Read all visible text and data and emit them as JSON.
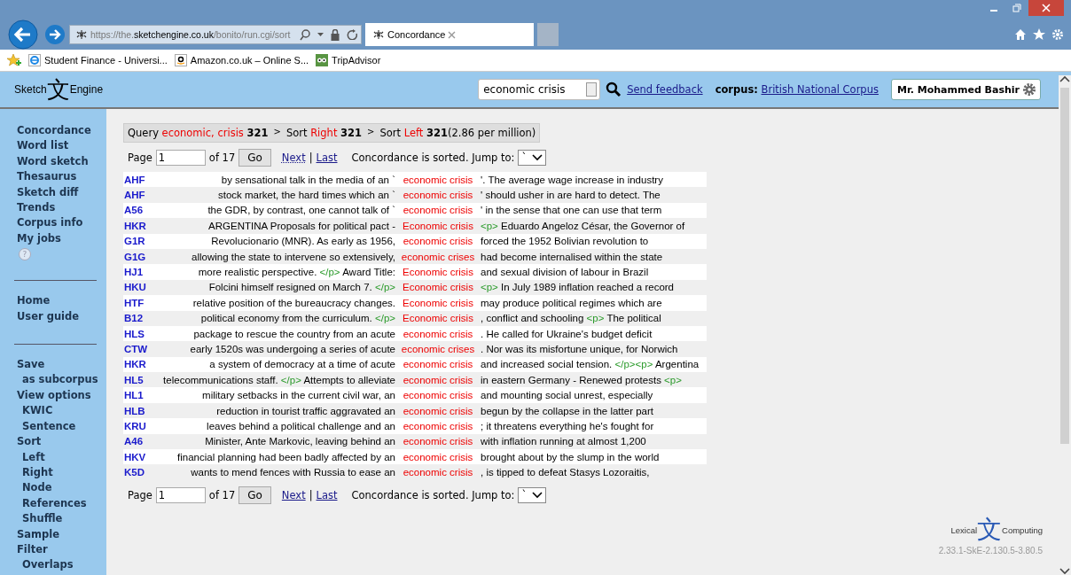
{
  "browser": {
    "address": {
      "scheme": "https://",
      "pre": "the.",
      "host": "sketchengine.co.uk",
      "path": "/bonito/run.cgi/sort"
    },
    "tab": "Concordance",
    "favorites": [
      {
        "kind": "edge",
        "label": "Student Finance - Universi..."
      },
      {
        "kind": "amazon",
        "label": "Amazon.co.uk – Online S..."
      },
      {
        "kind": "owl",
        "label": "TripAdvisor"
      }
    ]
  },
  "header": {
    "logo_glyph": "文",
    "logo_left": "Sketch",
    "logo_right": "Engine",
    "search": "economic crisis",
    "feedback": "Send feedback",
    "corpus_label": "corpus:",
    "corpus": "British National Corpus",
    "user": "Mr. Mohammed Bashir"
  },
  "sidebar": {
    "groups": [
      [
        {
          "label": "Concordance",
          "sub": false
        },
        {
          "label": "Word list",
          "sub": false
        },
        {
          "label": "Word sketch",
          "sub": false
        },
        {
          "label": "Thesaurus",
          "sub": false
        },
        {
          "label": "Sketch diff",
          "sub": false
        },
        {
          "label": "Trends",
          "sub": false
        },
        {
          "label": "Corpus info",
          "sub": false
        },
        {
          "label": "My jobs",
          "sub": false
        }
      ],
      [
        {
          "label": "Home",
          "sub": false
        },
        {
          "label": "User guide",
          "sub": false
        }
      ],
      [
        {
          "label": "Save",
          "sub": false
        },
        {
          "label": "as subcorpus",
          "sub": true
        },
        {
          "label": "View options",
          "sub": false
        },
        {
          "label": "KWIC",
          "sub": true
        },
        {
          "label": "Sentence",
          "sub": true
        },
        {
          "label": "Sort",
          "sub": false
        },
        {
          "label": "Left",
          "sub": true
        },
        {
          "label": "Right",
          "sub": true
        },
        {
          "label": "Node",
          "sub": true
        },
        {
          "label": "References",
          "sub": true
        },
        {
          "label": "Shuffle",
          "sub": true
        },
        {
          "label": "Sample",
          "sub": false
        },
        {
          "label": "Filter",
          "sub": false
        },
        {
          "label": "Overlaps",
          "sub": true
        }
      ]
    ]
  },
  "help": "?",
  "breadcrumb": [
    {
      "label": "Query",
      "value": "economic, crisis",
      "count": "321"
    },
    {
      "sep": ">",
      "label": "Sort",
      "value": "Right",
      "count": "321"
    },
    {
      "sep": ">",
      "label": "Sort",
      "value": "Left",
      "count": "321",
      "extra": "(2.86 per million)"
    }
  ],
  "pager_top": {
    "page_label": "Page",
    "page": "1",
    "of": "of 17",
    "go": "Go",
    "next": "Next",
    "sep": "|",
    "last": "Last",
    "note": "Concordance is sorted. Jump to:",
    "jump": "`"
  },
  "rows": [
    {
      "ref": "AHF",
      "left": [
        {
          "t": "by sensational talk in the media of an `",
          "tag": false
        }
      ],
      "kw": "economic crisis",
      "right": [
        {
          "t": "'. The average wage increase in industry",
          "tag": false
        }
      ]
    },
    {
      "ref": "AHF",
      "left": [
        {
          "t": "stock market, the hard times which an `",
          "tag": false
        }
      ],
      "kw": "economic crisis",
      "right": [
        {
          "t": "' should usher in are hard to detect. The",
          "tag": false
        }
      ]
    },
    {
      "ref": "A56",
      "left": [
        {
          "t": "the GDR, by contrast, one cannot talk of `",
          "tag": false
        }
      ],
      "kw": "economic crisis",
      "right": [
        {
          "t": "' in the sense that one can use that term",
          "tag": false
        }
      ]
    },
    {
      "ref": "HKR",
      "left": [
        {
          "t": "ARGENTINA Proposals for political pact -",
          "tag": false
        }
      ],
      "kw": "Economic crisis",
      "right": [
        {
          "t": "<p>",
          "tag": true
        },
        {
          "t": "Eduardo Angeloz César, the Governor of",
          "tag": false
        }
      ]
    },
    {
      "ref": "G1R",
      "left": [
        {
          "t": "Revolucionario (MNR). As early as 1956,",
          "tag": false
        }
      ],
      "kw": "economic crisis",
      "right": [
        {
          "t": "forced the 1952 Bolivian revolution to",
          "tag": false
        }
      ]
    },
    {
      "ref": "G1G",
      "left": [
        {
          "t": "allowing the state to intervene so extensively,",
          "tag": false
        }
      ],
      "kw": "economic crises",
      "right": [
        {
          "t": "had become internalised within the state",
          "tag": false
        }
      ]
    },
    {
      "ref": "HJ1",
      "left": [
        {
          "t": "more realistic perspective.",
          "tag": false
        },
        {
          "t": "</p>",
          "tag": true
        },
        {
          "t": "Award Title:",
          "tag": false
        }
      ],
      "kw": "Economic crisis",
      "right": [
        {
          "t": "and sexual division of labour in Brazil",
          "tag": false
        }
      ]
    },
    {
      "ref": "HKU",
      "left": [
        {
          "t": "Folcini himself resigned on March 7.",
          "tag": false
        },
        {
          "t": "</p>",
          "tag": true
        }
      ],
      "kw": "Economic crisis",
      "right": [
        {
          "t": "<p>",
          "tag": true
        },
        {
          "t": "In July 1989 inflation reached a record",
          "tag": false
        }
      ]
    },
    {
      "ref": "HTF",
      "left": [
        {
          "t": "relative position of the bureaucracy changes.",
          "tag": false
        }
      ],
      "kw": "Economic crisis",
      "right": [
        {
          "t": "may produce political regimes which are",
          "tag": false
        }
      ]
    },
    {
      "ref": "B12",
      "left": [
        {
          "t": "political economy from the curriculum.",
          "tag": false
        },
        {
          "t": "</p>",
          "tag": true
        }
      ],
      "kw": "Economic crisis",
      "right": [
        {
          "t": ", conflict and schooling",
          "tag": false
        },
        {
          "t": "<p>",
          "tag": true
        },
        {
          "t": "The political",
          "tag": false
        }
      ]
    },
    {
      "ref": "HLS",
      "left": [
        {
          "t": "package to rescue the country from an acute",
          "tag": false
        }
      ],
      "kw": "economic crisis",
      "right": [
        {
          "t": ". He called for Ukraine's budget deficit",
          "tag": false
        }
      ]
    },
    {
      "ref": "CTW",
      "left": [
        {
          "t": "early 1520s was undergoing a series of acute",
          "tag": false
        }
      ],
      "kw": "economic crises",
      "right": [
        {
          "t": ". Nor was its misfortune unique, for Norwich",
          "tag": false
        }
      ]
    },
    {
      "ref": "HKR",
      "left": [
        {
          "t": "a system of democracy at a time of acute",
          "tag": false
        }
      ],
      "kw": "economic crisis",
      "right": [
        {
          "t": "and increased social tension.",
          "tag": false
        },
        {
          "t": "</p><p>",
          "tag": true
        },
        {
          "t": "Argentina",
          "tag": false
        }
      ]
    },
    {
      "ref": "HL5",
      "left": [
        {
          "t": "telecommunications staff.",
          "tag": false
        },
        {
          "t": "</p>",
          "tag": true
        },
        {
          "t": "Attempts to alleviate",
          "tag": false
        }
      ],
      "kw": "economic crisis",
      "right": [
        {
          "t": "in eastern Germany - Renewed protests",
          "tag": false
        },
        {
          "t": "<p>",
          "tag": true
        }
      ]
    },
    {
      "ref": "HL1",
      "left": [
        {
          "t": "military setbacks in the current civil war, an",
          "tag": false
        }
      ],
      "kw": "economic crisis",
      "right": [
        {
          "t": "and mounting social unrest, especially",
          "tag": false
        }
      ]
    },
    {
      "ref": "HLB",
      "left": [
        {
          "t": "reduction in tourist traffic aggravated an",
          "tag": false
        }
      ],
      "kw": "economic crisis",
      "right": [
        {
          "t": "begun by the collapse in the latter part",
          "tag": false
        }
      ]
    },
    {
      "ref": "KRU",
      "left": [
        {
          "t": "leaves behind a political challenge and an",
          "tag": false
        }
      ],
      "kw": "economic crisis",
      "right": [
        {
          "t": "; it threatens everything he's fought for",
          "tag": false
        }
      ]
    },
    {
      "ref": "A46",
      "left": [
        {
          "t": "Minister, Ante Markovic, leaving behind an",
          "tag": false
        }
      ],
      "kw": "economic crisis",
      "right": [
        {
          "t": "with inflation running at almost 1,200",
          "tag": false
        }
      ]
    },
    {
      "ref": "HKV",
      "left": [
        {
          "t": "financial planning had been badly affected by an",
          "tag": false
        }
      ],
      "kw": "economic crisis",
      "right": [
        {
          "t": "brought about by the slump in the world",
          "tag": false
        }
      ]
    },
    {
      "ref": "K5D",
      "left": [
        {
          "t": "wants to mend fences with Russia to ease an",
          "tag": false
        }
      ],
      "kw": "economic crisis",
      "right": [
        {
          "t": ", is tipped to defeat Stasys Lozoraitis,",
          "tag": false
        }
      ]
    }
  ],
  "pager_bottom": {
    "page_label": "Page",
    "page": "1",
    "of": "of 17",
    "go": "Go",
    "next": "Next",
    "sep": "|",
    "last": "Last",
    "note": "Concordance is sorted. Jump to:",
    "jump": "`"
  },
  "footer": {
    "logo_glyph": "文",
    "logo_left": "Lexical",
    "logo_right": "Computing",
    "version": "2.33.1-SkE-2.130.5-3.80.5"
  }
}
